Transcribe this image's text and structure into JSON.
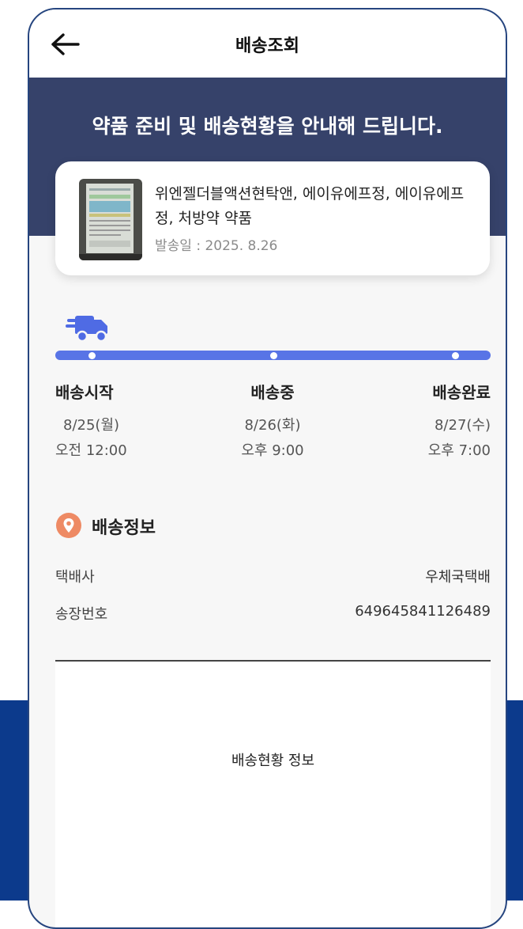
{
  "header": {
    "title": "배송조회",
    "back_icon": "arrow-left-icon"
  },
  "banner": {
    "text": "약품 준비 및 배송현황을 안내해 드립니다.",
    "color": "#36426a"
  },
  "product": {
    "name": "위엔젤더블액션현탁앤, 에이유에프정, 에이유에프정, 처방약 약품",
    "ship_date": "발송일 :  2025. 8.26"
  },
  "progress": {
    "icon": "delivery-truck-icon",
    "accent": "#5874e6",
    "steps": [
      {
        "label": "배송시작",
        "date": "8/25(월)",
        "time": "오전 12:00"
      },
      {
        "label": "배송중",
        "date": "8/26(화)",
        "time": "오후 9:00"
      },
      {
        "label": "배송완료",
        "date": "8/27(수)",
        "time": "오후 7:00"
      }
    ]
  },
  "delivery_info": {
    "title": "배송정보",
    "icon": "location-pin-icon",
    "courier_label": "택배사",
    "courier_value": "우체국택배",
    "tracking_label": "송장번호",
    "tracking_value": "649645841126489"
  },
  "status": {
    "text": "배송현황 정보"
  }
}
